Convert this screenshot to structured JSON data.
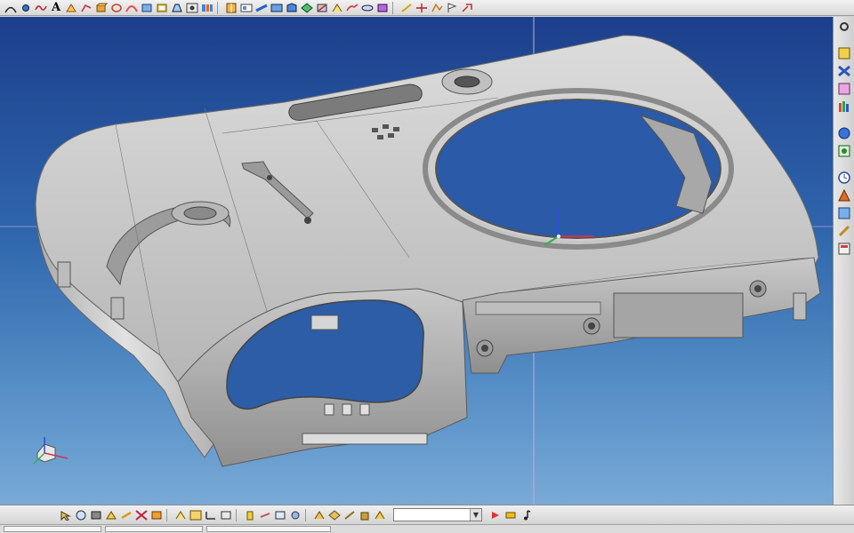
{
  "window": {
    "title": ""
  },
  "colors": {
    "viewport_top": "#1c3f8c",
    "viewport_bottom": "#79aad6",
    "model_gray": "#b9b9b9",
    "axis_x": "#d0305a",
    "axis_y": "#2fb34a",
    "axis_z": "#2f4fd6"
  },
  "top_toolbar": {
    "text_tool_glyph": "A",
    "icons": [
      "sketch-curve-icon",
      "point-icon",
      "curve-icon",
      "text-tool-icon",
      "sketch-line-icon",
      "fillet-icon",
      "extrude-icon",
      "revolve-icon",
      "sweep-icon",
      "loft-icon",
      "shell-icon",
      "draft-icon",
      "hole-icon",
      "pattern-icon",
      "mirror-icon",
      "boolean-icon",
      "measure-icon",
      "section-icon",
      "render-icon",
      "surface-icon",
      "trim-icon",
      "extend-icon",
      "offset-icon",
      "thicken-icon",
      "blend-icon"
    ]
  },
  "right_toolbar": {
    "icons": [
      "settings-gear-icon",
      "layer-icon",
      "constraint-icon",
      "feature-icon",
      "part-navigator-icon",
      "assembly-navigator-icon",
      "view-icon",
      "history-icon",
      "material-icon",
      "analysis-icon",
      "sketch-icon",
      "roles-icon"
    ]
  },
  "bottom_toolbar": {
    "combo_value": "",
    "icons": [
      "select-icon",
      "view-orient-icon",
      "shade-icon",
      "fit-icon",
      "rotate-icon",
      "pan-icon",
      "zoom-icon",
      "snap-icon",
      "filter-icon",
      "wcs-icon",
      "layer-settings-icon",
      "hide-icon",
      "show-icon",
      "edit-object-icon",
      "display-icon",
      "clip-icon",
      "selection-filter-icon",
      "sound-icon"
    ]
  },
  "scene": {
    "object": "camera-body-front-shell",
    "shaded": true
  }
}
